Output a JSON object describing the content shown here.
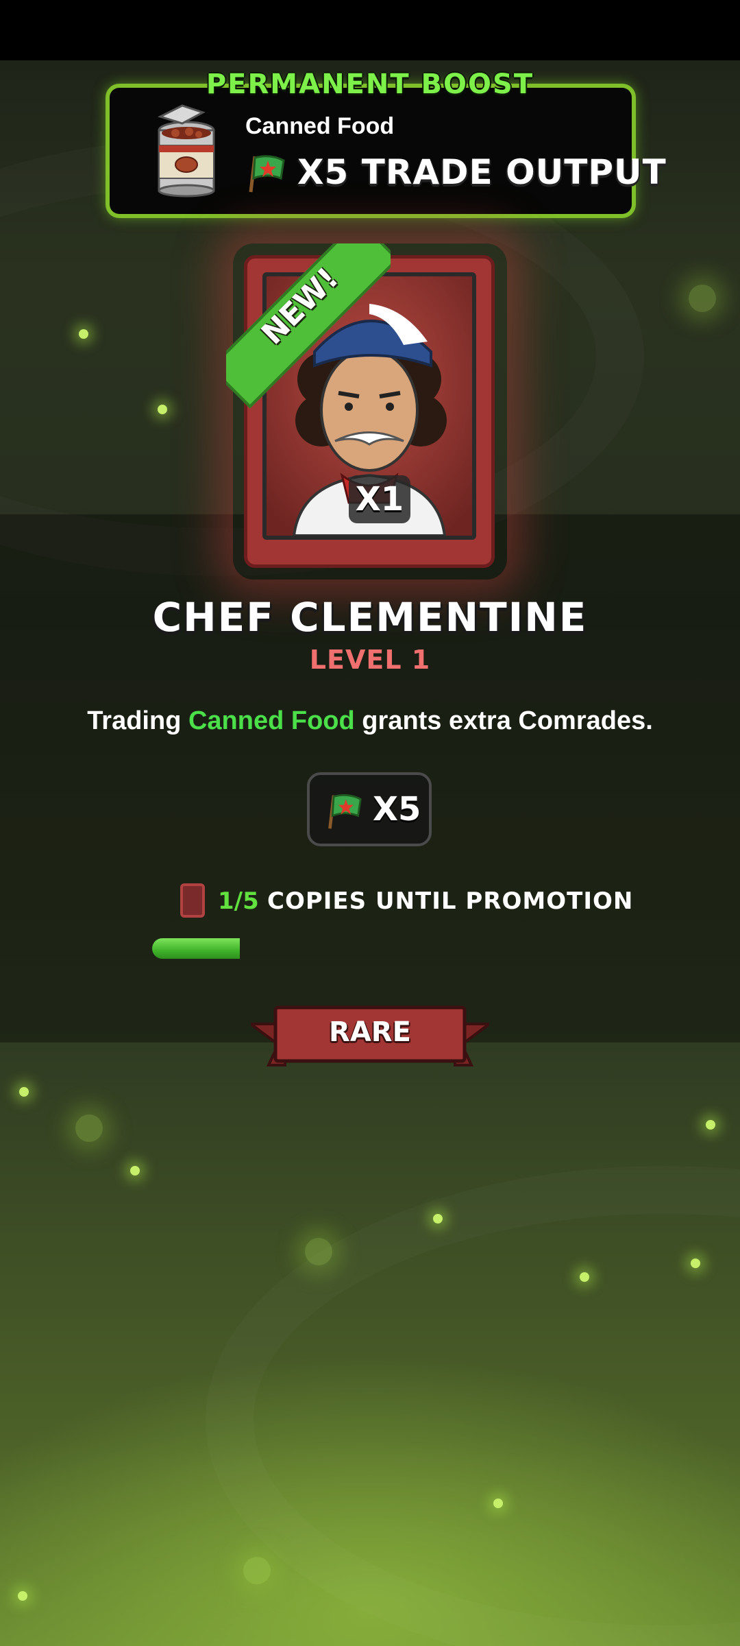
{
  "boost": {
    "title": "PERMANENT BOOST",
    "item_name": "Canned Food",
    "effect": "X5 TRADE OUTPUT"
  },
  "card": {
    "new_badge": "NEW!",
    "count_badge": "X1"
  },
  "hero": {
    "name": "CHEF CLEMENTINE",
    "level": "LEVEL 1",
    "description_prefix": "Trading ",
    "description_highlight": "Canned Food",
    "description_suffix": " grants extra Comrades."
  },
  "reward": {
    "value": "X5",
    "icon": "comrade-flag-icon"
  },
  "promotion": {
    "copies": "1/5",
    "label": "COPIES UNTIL PROMOTION",
    "progress_fraction": 0.2
  },
  "rarity": {
    "label": "RARE"
  },
  "colors": {
    "accent_green": "#61e03f",
    "rarity_red": "#a23634",
    "level_red": "#f07070"
  }
}
